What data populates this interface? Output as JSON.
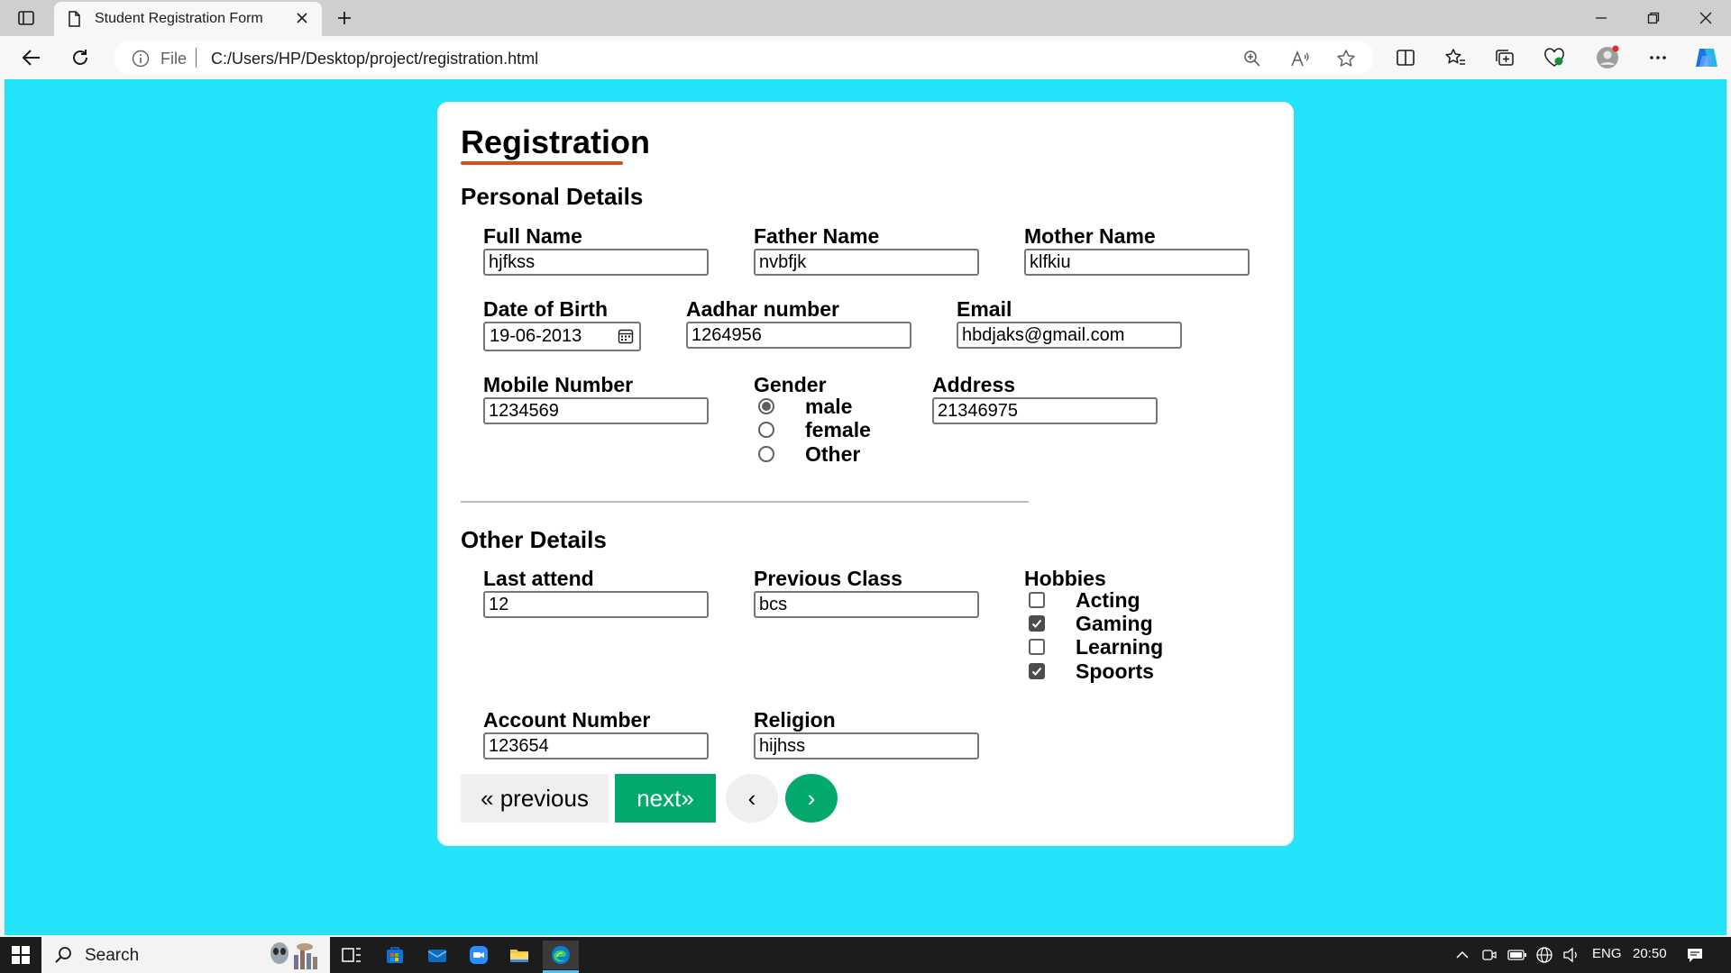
{
  "browser": {
    "tab_title": "Student Registration Form",
    "scheme_label": "File",
    "url": "C:/Users/HP/Desktop/project/registration.html"
  },
  "form": {
    "title": "Registration",
    "personal_section": "Personal Details",
    "other_section": "Other Details",
    "fields": {
      "full_name": {
        "label": "Full Name",
        "value": "hjfkss"
      },
      "father_name": {
        "label": "Father Name",
        "value": "nvbfjk"
      },
      "mother_name": {
        "label": "Mother Name",
        "value": "klfkiu"
      },
      "dob": {
        "label": "Date of Birth",
        "value": "19-06-2013"
      },
      "aadhar": {
        "label": "Aadhar number",
        "value": "1264956"
      },
      "email": {
        "label": "Email",
        "value": "hbdjaks@gmail.com"
      },
      "mobile": {
        "label": "Mobile Number",
        "value": "1234569"
      },
      "address": {
        "label": "Address",
        "value": "21346975"
      },
      "last_attend": {
        "label": "Last attend",
        "value": "12"
      },
      "previous_class": {
        "label": "Previous Class",
        "value": "bcs"
      },
      "account_number": {
        "label": "Account Number",
        "value": "123654"
      },
      "religion": {
        "label": "Religion",
        "value": "hijhss"
      }
    },
    "gender": {
      "label": "Gender",
      "options": [
        {
          "label": "male",
          "checked": true
        },
        {
          "label": "female",
          "checked": false
        },
        {
          "label": "Other",
          "checked": false
        }
      ]
    },
    "hobbies": {
      "label": "Hobbies",
      "options": [
        {
          "label": "Acting",
          "checked": false
        },
        {
          "label": "Gaming",
          "checked": true
        },
        {
          "label": "Learning",
          "checked": false
        },
        {
          "label": "Spoorts",
          "checked": true
        }
      ]
    },
    "buttons": {
      "previous": "« previous",
      "next": "next»",
      "left_arrow": "‹",
      "right_arrow": "›"
    }
  },
  "taskbar": {
    "search_label": "Search",
    "language": "ENG",
    "time": "20:50"
  },
  "colors": {
    "page_background": "#23e3fb",
    "accent_green": "#04aa6d",
    "title_underline": "#cf5417"
  }
}
